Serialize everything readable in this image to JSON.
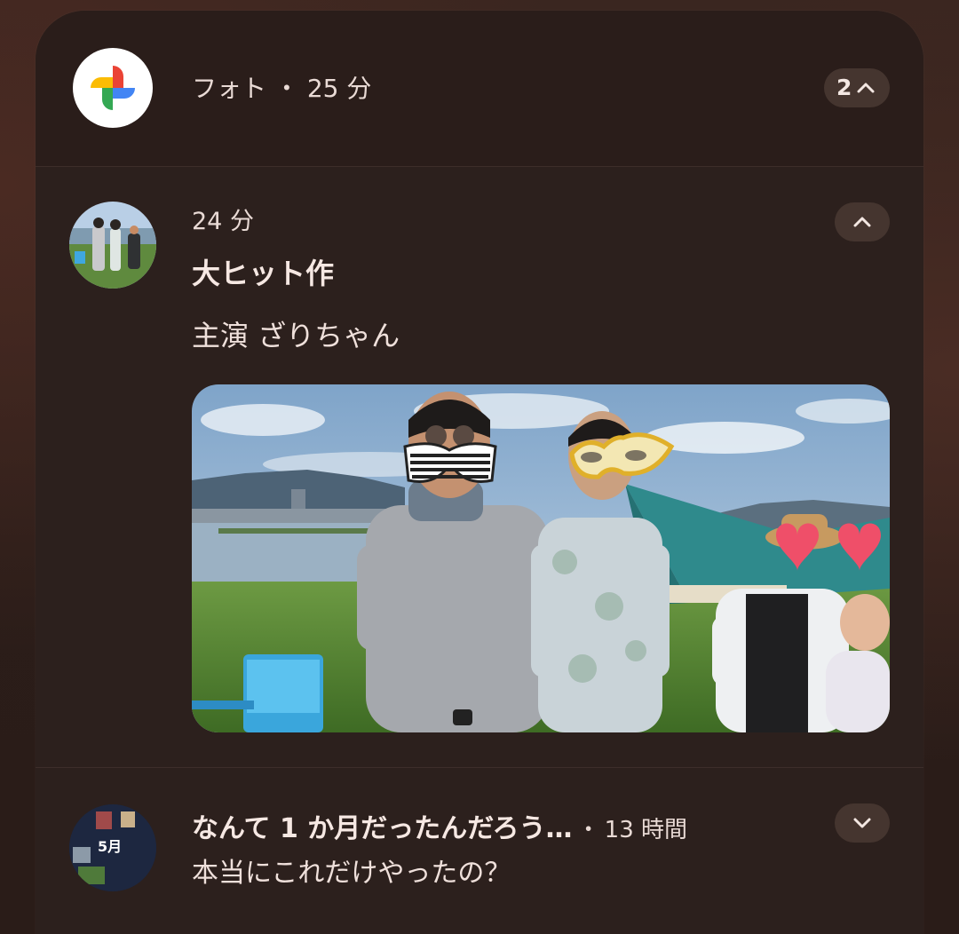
{
  "group": {
    "app_name": "フォト",
    "separator": "・",
    "time": "25 分",
    "count": "2",
    "app_icon": "google-photos-pinwheel-icon",
    "expand_icon": "chevron-up-icon"
  },
  "notification1": {
    "time": "24 分",
    "title": "大ヒット作",
    "body": "主演 ざりちゃん",
    "collapse_icon": "chevron-up-icon"
  },
  "notification2": {
    "avatar_label": "5月",
    "title": "なんて 1 か月だったんだろう…",
    "separator": "・",
    "time": "13 時間",
    "body": "本当にこれだけやったの？",
    "expand_icon": "chevron-down-icon"
  },
  "colors": {
    "panel": "#2c201d",
    "pill": "#45352f",
    "text_primary": "#f6e8e3",
    "text_secondary": "#e9dad5"
  }
}
